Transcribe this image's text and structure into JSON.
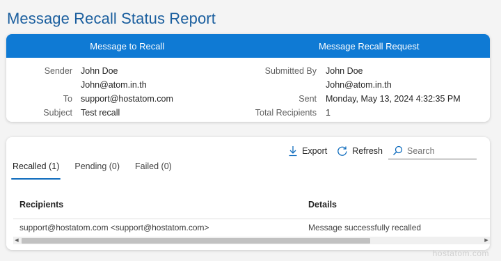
{
  "page_title": "Message Recall Status Report",
  "summary": {
    "left_header": "Message to Recall",
    "right_header": "Message Recall Request",
    "sender_label": "Sender",
    "sender_name": "John Doe",
    "sender_email": "John@atom.in.th",
    "to_label": "To",
    "to_value": "support@hostatom.com",
    "subject_label": "Subject",
    "subject_value": "Test recall",
    "submitted_by_label": "Submitted By",
    "submitted_by_name": "John Doe",
    "submitted_by_email": "John@atom.in.th",
    "sent_label": "Sent",
    "sent_value": "Monday, May 13, 2024 4:32:35 PM",
    "total_recipients_label": "Total Recipients",
    "total_recipients_value": "1"
  },
  "toolbar": {
    "export_label": "Export",
    "refresh_label": "Refresh",
    "search_placeholder": "Search"
  },
  "tabs": [
    {
      "label": "Recalled (1)",
      "active": true
    },
    {
      "label": "Pending (0)",
      "active": false
    },
    {
      "label": "Failed (0)",
      "active": false
    }
  ],
  "table": {
    "columns": [
      "Recipients",
      "Details"
    ],
    "rows": [
      [
        "support@hostatom.com <support@hostatom.com>",
        "Message successfully recalled"
      ]
    ]
  },
  "watermark": "hostatom.com",
  "colors": {
    "accent": "#0f7ad4",
    "title": "#1a5e9e"
  }
}
